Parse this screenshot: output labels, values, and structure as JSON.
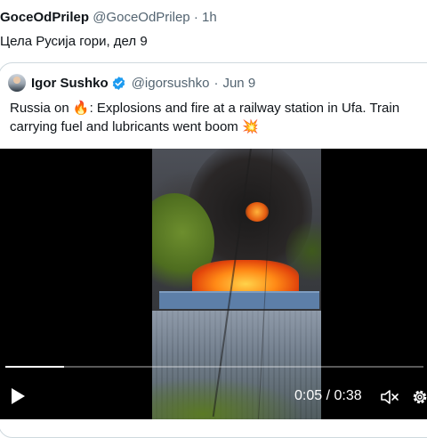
{
  "tweet": {
    "author_name": "GoceOdPrilep",
    "author_handle": "@GoceOdPrilep",
    "separator": "·",
    "time": "1h",
    "text": "Цела Русија гори, дел 9"
  },
  "quote": {
    "author_name": "Igor Sushko",
    "author_handle": "@igorsushko",
    "separator": "·",
    "date": "Jun 9",
    "verified_icon": "verified-badge-icon",
    "text_part1": "Russia on ",
    "fire_emoji": "🔥",
    "text_part2": ": Explosions and fire at a railway station in Ufa. Train",
    "text_line2": "carrying fuel and lubricants went boom ",
    "boom_emoji": "💥"
  },
  "video": {
    "current_time": "0:05",
    "time_separator": " / ",
    "duration": "0:38",
    "progress": 0.14,
    "icons": {
      "play": "play-icon",
      "mute": "muted-speaker-icon",
      "settings": "gear-icon"
    }
  },
  "colors": {
    "accent_blue": "#1d9bf0",
    "text_primary": "#0f1419",
    "text_secondary": "#536471",
    "border": "#cfd9de"
  }
}
